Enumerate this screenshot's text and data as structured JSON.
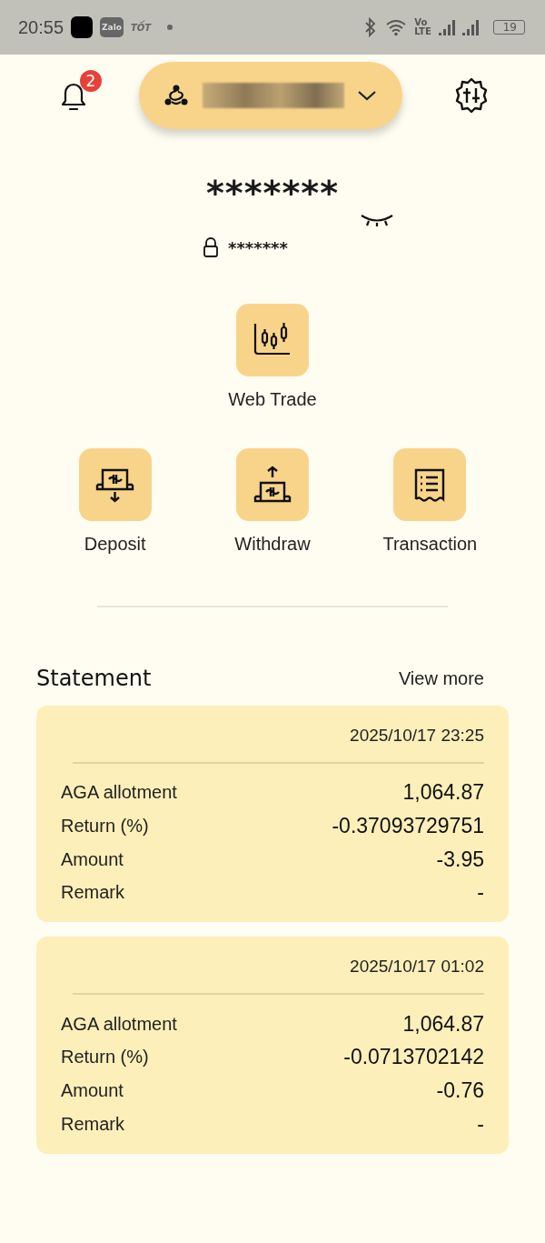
{
  "status_bar": {
    "time": "20:55",
    "app_labels": [
      "Zalo",
      "TỐT"
    ],
    "network": [
      "Vo",
      "LTE"
    ],
    "battery": "19"
  },
  "header": {
    "notification_count": "2"
  },
  "balance": {
    "main": "*******",
    "locked": "*******",
    "hidden": true
  },
  "actions": [
    {
      "label": "Web Trade",
      "kind": "trade"
    },
    {
      "label": "Deposit",
      "kind": "deposit"
    },
    {
      "label": "Withdraw",
      "kind": "withdraw"
    },
    {
      "label": "Transaction",
      "kind": "transaction"
    }
  ],
  "statement": {
    "title": "Statement",
    "view_more": "View more",
    "entries": [
      {
        "date": "2025/10/17 23:25",
        "rows": [
          {
            "label": "AGA allotment",
            "value": "1,064.87"
          },
          {
            "label": "Return (%)",
            "value": "-0.37093729751"
          },
          {
            "label": "Amount",
            "value": "-3.95"
          },
          {
            "label": "Remark",
            "value": "-"
          }
        ]
      },
      {
        "date": "2025/10/17 01:02",
        "rows": [
          {
            "label": "AGA allotment",
            "value": "1,064.87"
          },
          {
            "label": "Return (%)",
            "value": "-0.0713702142"
          },
          {
            "label": "Amount",
            "value": "-0.76"
          },
          {
            "label": "Remark",
            "value": "-"
          }
        ]
      }
    ]
  }
}
